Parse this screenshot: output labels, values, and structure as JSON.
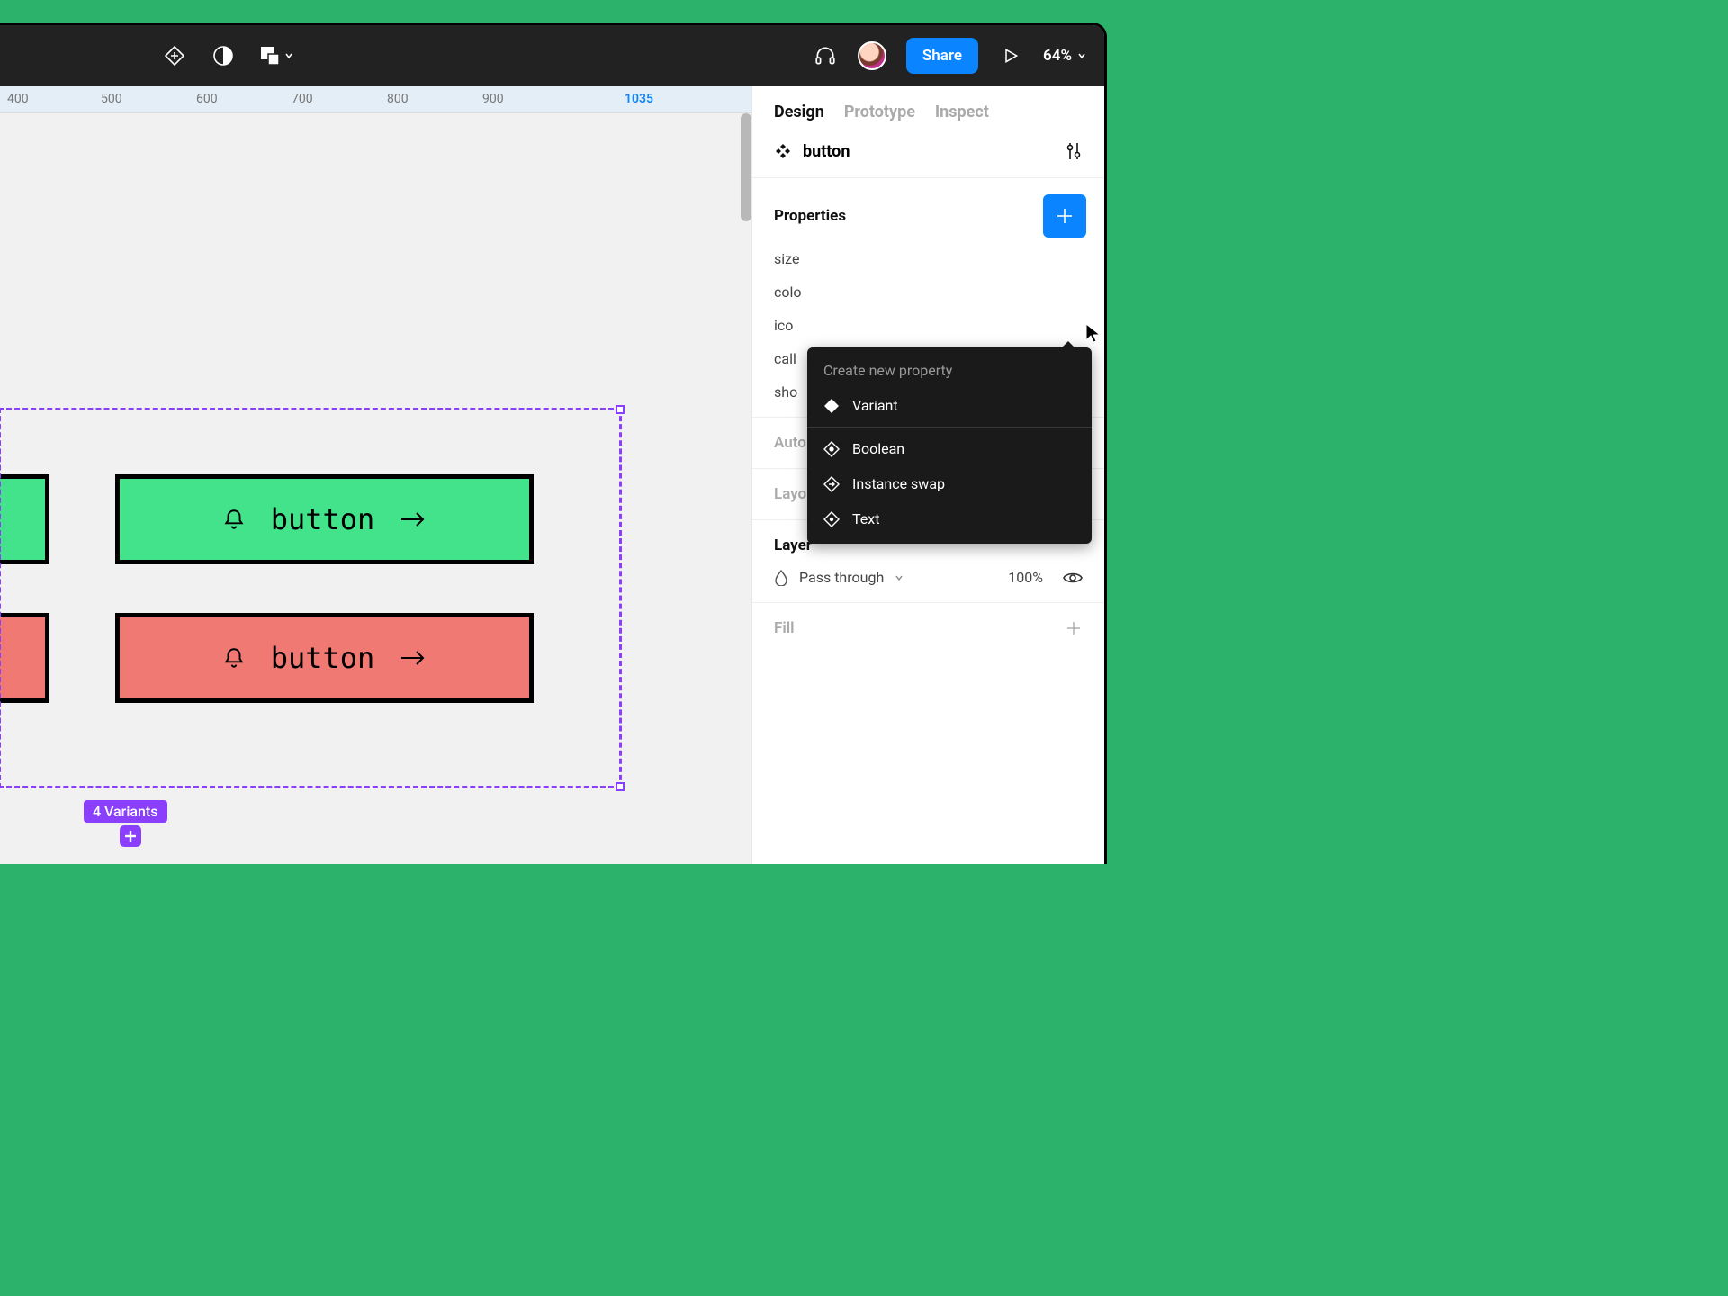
{
  "toolbar": {
    "share_label": "Share",
    "zoom_label": "64%"
  },
  "ruler": {
    "ticks": [
      "400",
      "500",
      "600",
      "700",
      "800",
      "900"
    ],
    "active": "1035"
  },
  "canvas": {
    "button_label_1": "button",
    "button_label_2": "button",
    "variants_badge": "4 Variants"
  },
  "panel": {
    "tabs": [
      "Design",
      "Prototype",
      "Inspect"
    ],
    "component_name": "button",
    "properties_title": "Properties",
    "properties": [
      "size",
      "colo",
      "ico",
      "call",
      "sho"
    ],
    "auto_layout": "Auto layout",
    "layout_grid": "Layout grid",
    "layer_title": "Layer",
    "blend_mode": "Pass through",
    "opacity": "100%",
    "fill_title": "Fill"
  },
  "dropdown": {
    "title": "Create new property",
    "variant": "Variant",
    "boolean": "Boolean",
    "instance_swap": "Instance swap",
    "text": "Text"
  }
}
